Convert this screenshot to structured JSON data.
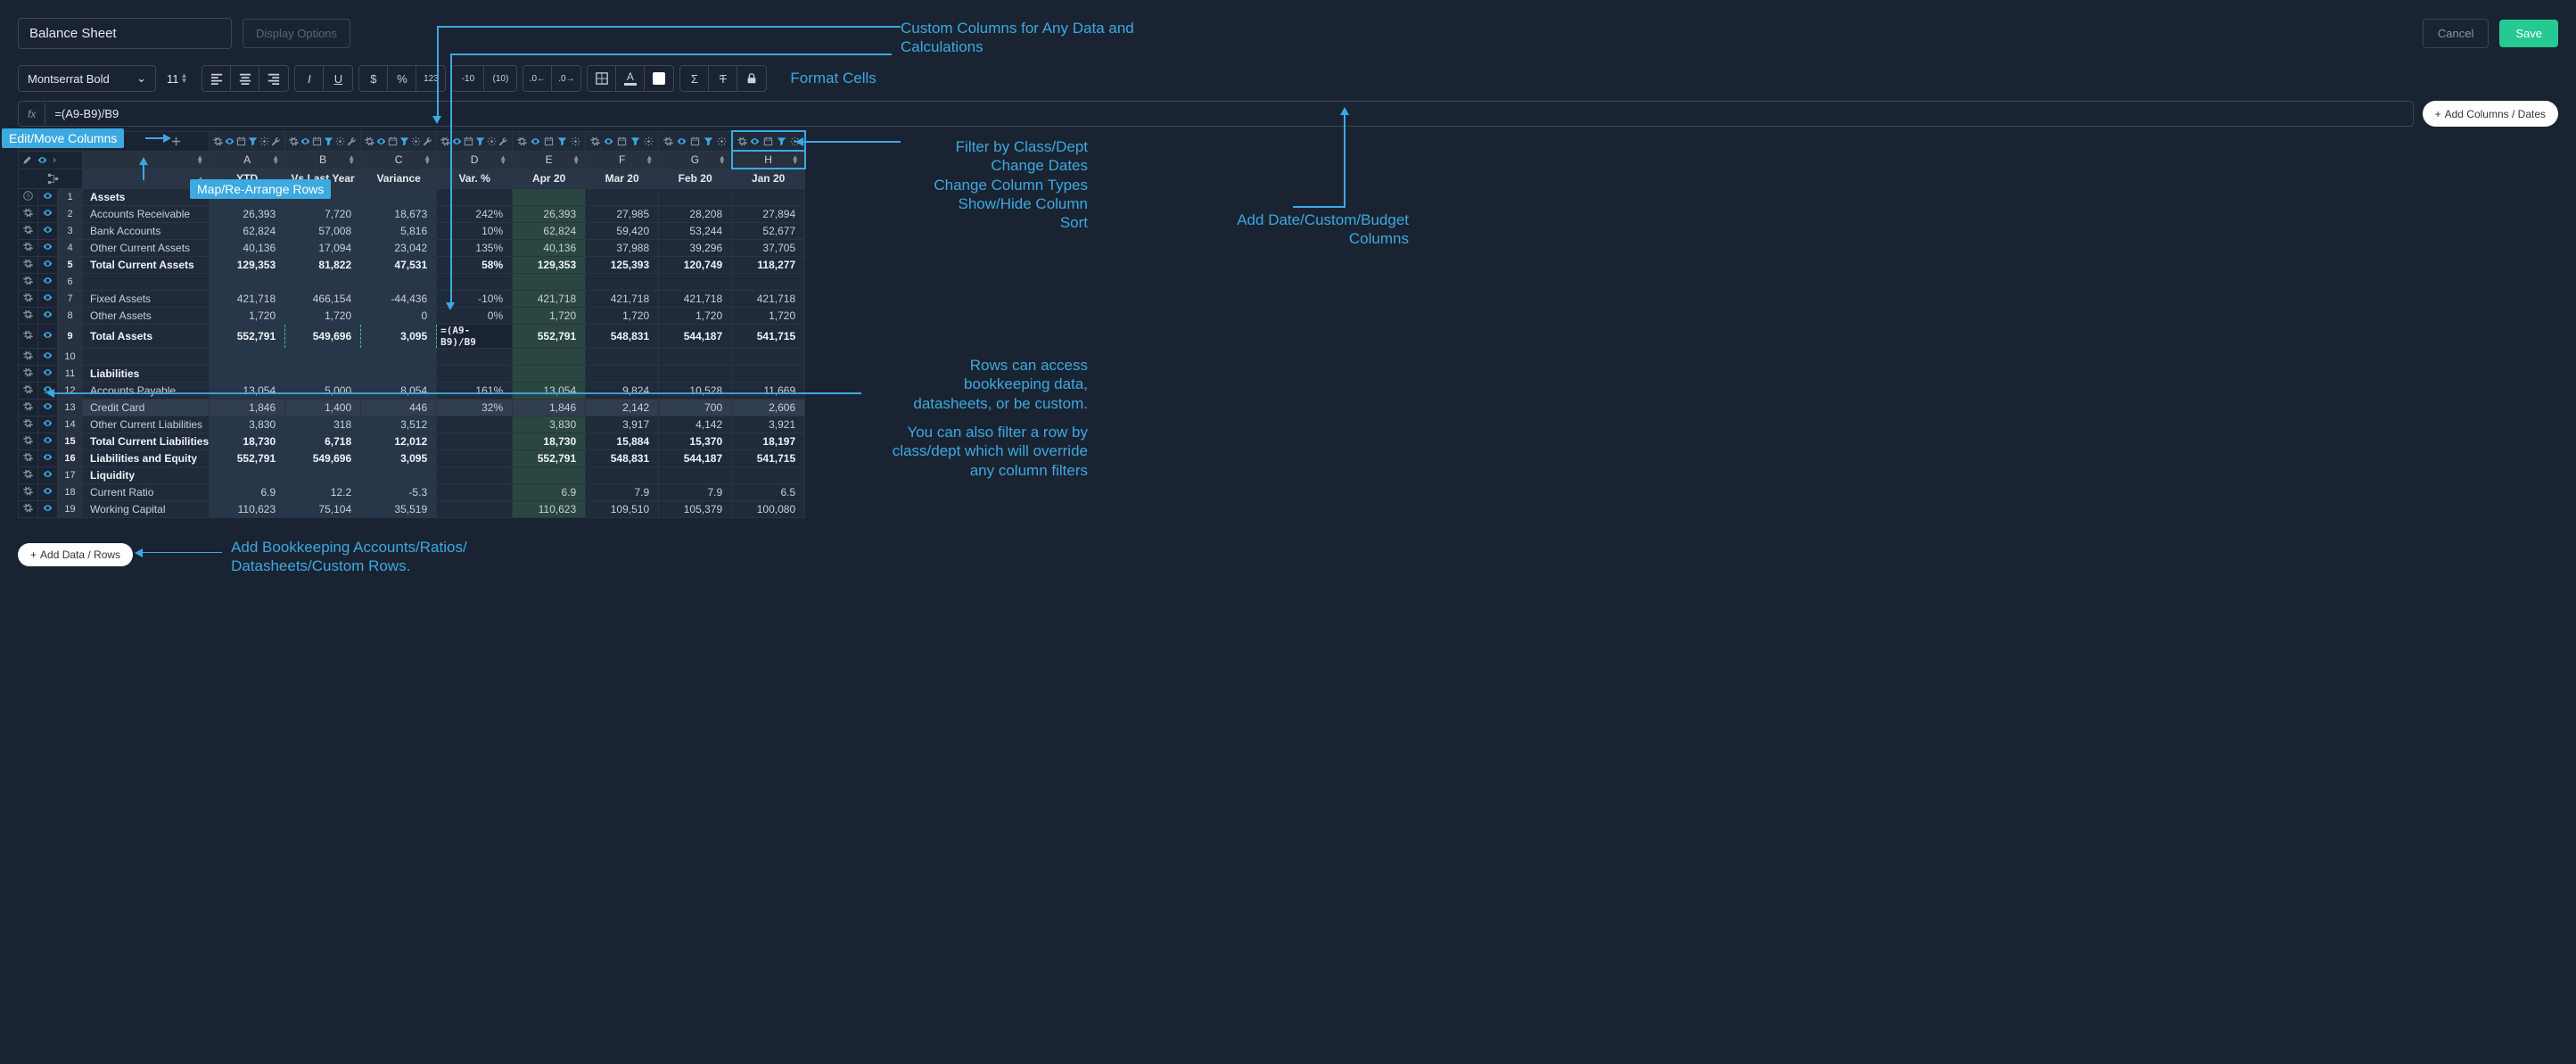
{
  "header": {
    "title": "Balance Sheet",
    "display_options": "Display Options",
    "cancel": "Cancel",
    "save": "Save"
  },
  "toolbar": {
    "font": "Montserrat Bold",
    "size": "11",
    "neg_paren_a": "-10",
    "neg_paren_b": "(10)",
    "format_cells_label": "Format Cells"
  },
  "formula": {
    "fx": "fx",
    "value": "=(A9-B9)/B9",
    "add_columns": "Add Columns / Dates"
  },
  "columns": {
    "letters": [
      "A",
      "B",
      "C",
      "D",
      "E",
      "F",
      "G",
      "H"
    ],
    "names": [
      "YTD",
      "Vs Last Year",
      "Variance",
      "Var. %",
      "Apr 20",
      "Mar 20",
      "Feb 20",
      "Jan 20"
    ]
  },
  "rows": [
    {
      "n": 1,
      "label": "Assets",
      "type": "section",
      "cells": [
        "",
        "",
        "",
        "",
        "",
        "",
        "",
        ""
      ]
    },
    {
      "n": 2,
      "label": "Accounts Receivable",
      "type": "data",
      "cells": [
        "26,393",
        "7,720",
        "18,673",
        "242%",
        "26,393",
        "27,985",
        "28,208",
        "27,894"
      ]
    },
    {
      "n": 3,
      "label": "Bank Accounts",
      "type": "data",
      "cells": [
        "62,824",
        "57,008",
        "5,816",
        "10%",
        "62,824",
        "59,420",
        "53,244",
        "52,677"
      ]
    },
    {
      "n": 4,
      "label": "Other Current Assets",
      "type": "data",
      "cells": [
        "40,136",
        "17,094",
        "23,042",
        "135%",
        "40,136",
        "37,988",
        "39,296",
        "37,705"
      ]
    },
    {
      "n": 5,
      "label": "Total Current Assets",
      "type": "total",
      "cells": [
        "129,353",
        "81,822",
        "47,531",
        "58%",
        "129,353",
        "125,393",
        "120,749",
        "118,277"
      ]
    },
    {
      "n": 6,
      "label": "",
      "type": "blank",
      "cells": [
        "",
        "",
        "",
        "",
        "",
        "",
        "",
        ""
      ]
    },
    {
      "n": 7,
      "label": "Fixed Assets",
      "type": "data",
      "cells": [
        "421,718",
        "466,154",
        "-44,436",
        "-10%",
        "421,718",
        "421,718",
        "421,718",
        "421,718"
      ]
    },
    {
      "n": 8,
      "label": "Other Assets",
      "type": "data",
      "cells": [
        "1,720",
        "1,720",
        "0",
        "0%",
        "1,720",
        "1,720",
        "1,720",
        "1,720"
      ]
    },
    {
      "n": 9,
      "label": "Total Assets",
      "type": "total",
      "cells": [
        "552,791",
        "549,696",
        "3,095",
        "=(A9-B9)/B9",
        "552,791",
        "548,831",
        "544,187",
        "541,715"
      ],
      "editing": 3
    },
    {
      "n": 10,
      "label": "",
      "type": "blank",
      "cells": [
        "",
        "",
        "",
        "",
        "",
        "",
        "",
        ""
      ]
    },
    {
      "n": 11,
      "label": "Liabilities",
      "type": "section",
      "cells": [
        "",
        "",
        "",
        "",
        "",
        "",
        "",
        ""
      ]
    },
    {
      "n": 12,
      "label": "Accounts Payable",
      "type": "data",
      "cells": [
        "13,054",
        "5,000",
        "8,054",
        "161%",
        "13,054",
        "9,824",
        "10,528",
        "11,669"
      ]
    },
    {
      "n": 13,
      "label": "Credit Card",
      "type": "data",
      "highlight": true,
      "cells": [
        "1,846",
        "1,400",
        "446",
        "32%",
        "1,846",
        "2,142",
        "700",
        "2,606"
      ]
    },
    {
      "n": 14,
      "label": "Other Current Liabilities",
      "type": "data",
      "cells": [
        "3,830",
        "318",
        "3,512",
        "",
        "3,830",
        "3,917",
        "4,142",
        "3,921"
      ]
    },
    {
      "n": 15,
      "label": "Total Current Liabilities",
      "type": "total",
      "cells": [
        "18,730",
        "6,718",
        "12,012",
        "",
        "18,730",
        "15,884",
        "15,370",
        "18,197"
      ]
    },
    {
      "n": 16,
      "label": "Liabilities and Equity",
      "type": "total",
      "cells": [
        "552,791",
        "549,696",
        "3,095",
        "",
        "552,791",
        "548,831",
        "544,187",
        "541,715"
      ]
    },
    {
      "n": 17,
      "label": "Liquidity",
      "type": "section",
      "cells": [
        "",
        "",
        "",
        "",
        "",
        "",
        "",
        ""
      ]
    },
    {
      "n": 18,
      "label": "Current Ratio",
      "type": "data",
      "cells": [
        "6.9",
        "12.2",
        "-5.3",
        "",
        "6.9",
        "7.9",
        "7.9",
        "6.5"
      ]
    },
    {
      "n": 19,
      "label": "Working Capital",
      "type": "data",
      "cells": [
        "110,623",
        "75,104",
        "35,519",
        "",
        "110,623",
        "109,510",
        "105,379",
        "100,080"
      ]
    }
  ],
  "annotations": {
    "edit_move_cols": "Edit/Move Columns",
    "map_rows": "Map/Re-Arrange Rows",
    "custom_cols": "Custom Columns for Any Data and Calculations",
    "filter_block": "Filter by Class/Dept\nChange Dates\nChange Column Types\nShow/Hide Column\nSort",
    "add_date_cols": "Add Date/Custom/Budget Columns",
    "rows_access": "Rows can access bookkeeping data, datasheets, or be custom.",
    "rows_filter": "You can also filter a row by class/dept which will override any column filters",
    "add_rows_desc": "Add Bookkeeping Accounts/Ratios/ Datasheets/Custom Rows.",
    "add_rows_btn": "Add Data / Rows"
  }
}
